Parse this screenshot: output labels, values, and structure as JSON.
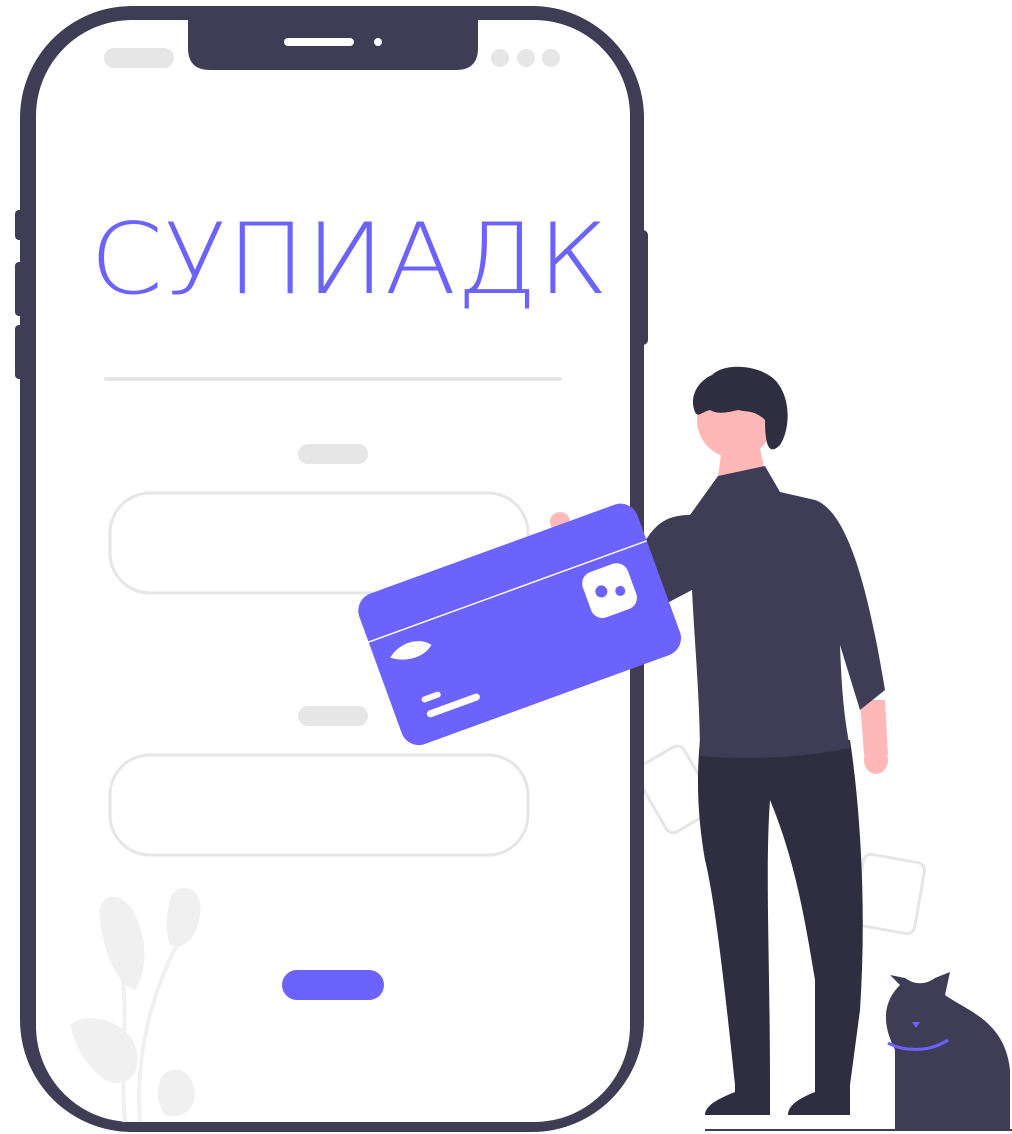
{
  "app": {
    "logo_text": "СУПИАДК"
  },
  "colors": {
    "accent": "#6c63ff",
    "phone_frame": "#3f3d56",
    "placeholder": "#e6e6e6",
    "person_dark": "#2f2e41",
    "skin": "#ffb8b8",
    "background": "#ffffff"
  },
  "icons": {
    "phone_notch": "phone-notch-icon",
    "credit_card": "credit-card-icon",
    "person": "person-illustration",
    "cat": "cat-illustration",
    "plant": "plant-illustration"
  }
}
